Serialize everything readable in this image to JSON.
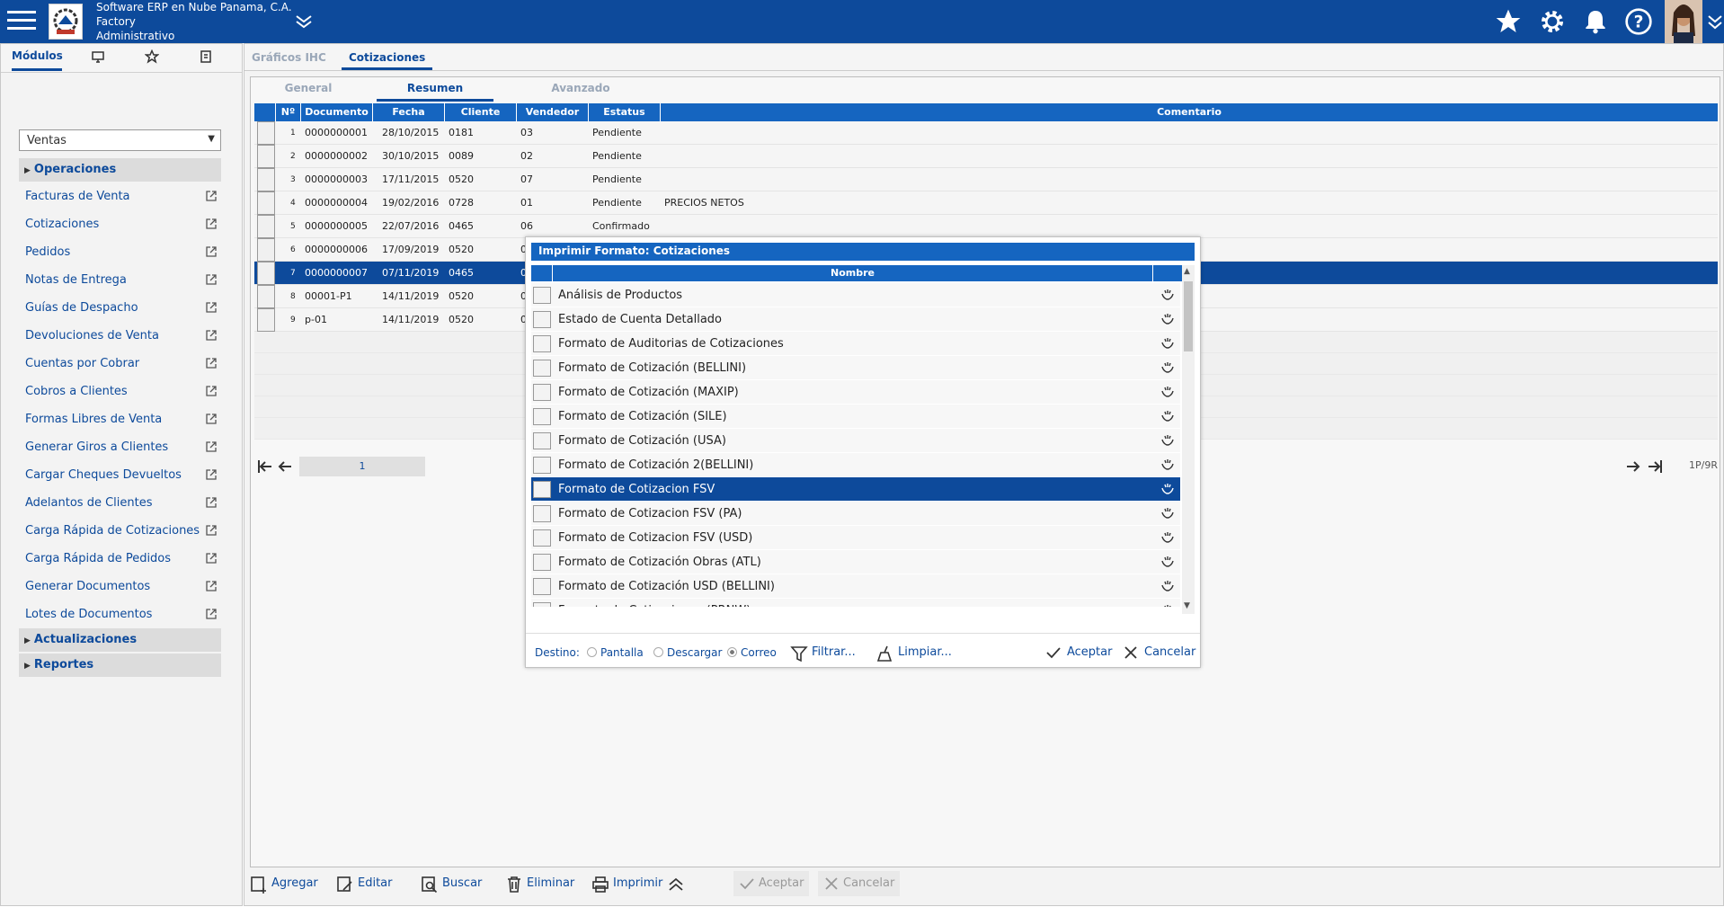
{
  "header": {
    "company": "Software ERP en Nube Panama, C.A.",
    "factory": "Factory",
    "role": "Administrativo"
  },
  "left": {
    "tabs": {
      "modulos": "Módulos"
    },
    "select_value": "Ventas",
    "sections": {
      "operaciones": "Operaciones",
      "actualizaciones": "Actualizaciones",
      "reportes": "Reportes"
    },
    "items": [
      "Facturas de Venta",
      "Cotizaciones",
      "Pedidos",
      "Notas de Entrega",
      "Guías de Despacho",
      "Devoluciones de Venta",
      "Cuentas por Cobrar",
      "Cobros a Clientes",
      "Formas Libres de Venta",
      "Generar Giros a Clientes",
      "Cargar Cheques Devueltos",
      "Adelantos de Clientes",
      "Carga Rápida de Cotizaciones",
      "Carga Rápida de Pedidos",
      "Generar Documentos",
      "Lotes de Documentos"
    ]
  },
  "main": {
    "tabs": [
      "Gráficos IHC",
      "Cotizaciones"
    ],
    "inner_tabs": [
      "General",
      "Resumen",
      "Avanzado"
    ],
    "columns": [
      "Nº",
      "Documento",
      "Fecha",
      "Cliente",
      "Vendedor",
      "Estatus",
      "Comentario"
    ],
    "rows": [
      {
        "n": "1",
        "doc": "0000000001",
        "fecha": "28/10/2015",
        "cliente": "0181",
        "vend": "03",
        "estatus": "Pendiente",
        "coment": ""
      },
      {
        "n": "2",
        "doc": "0000000002",
        "fecha": "30/10/2015",
        "cliente": "0089",
        "vend": "02",
        "estatus": "Pendiente",
        "coment": ""
      },
      {
        "n": "3",
        "doc": "0000000003",
        "fecha": "17/11/2015",
        "cliente": "0520",
        "vend": "07",
        "estatus": "Pendiente",
        "coment": ""
      },
      {
        "n": "4",
        "doc": "0000000004",
        "fecha": "19/02/2016",
        "cliente": "0728",
        "vend": "01",
        "estatus": "Pendiente",
        "coment": "PRECIOS NETOS"
      },
      {
        "n": "5",
        "doc": "0000000005",
        "fecha": "22/07/2016",
        "cliente": "0465",
        "vend": "06",
        "estatus": "Confirmado",
        "coment": ""
      },
      {
        "n": "6",
        "doc": "0000000006",
        "fecha": "17/09/2019",
        "cliente": "0520",
        "vend": "0",
        "estatus": "",
        "coment": ""
      },
      {
        "n": "7",
        "doc": "0000000007",
        "fecha": "07/11/2019",
        "cliente": "0465",
        "vend": "0",
        "estatus": "",
        "coment": ""
      },
      {
        "n": "8",
        "doc": "00001-P1",
        "fecha": "14/11/2019",
        "cliente": "0520",
        "vend": "0",
        "estatus": "",
        "coment": ""
      },
      {
        "n": "9",
        "doc": "p-01",
        "fecha": "14/11/2019",
        "cliente": "0520",
        "vend": "0",
        "estatus": "",
        "coment": ""
      }
    ],
    "pager": {
      "page": "1",
      "info": "1P/9R"
    },
    "actions": {
      "agregar": "Agregar",
      "editar": "Editar",
      "buscar": "Buscar",
      "eliminar": "Eliminar",
      "imprimir": "Imprimir",
      "aceptar": "Aceptar",
      "cancelar": "Cancelar"
    }
  },
  "modal": {
    "title": "Imprimir Formato: Cotizaciones",
    "column": "Nombre",
    "items": [
      "Análisis de Productos",
      "Estado de Cuenta Detallado",
      "Formato de Auditorias de Cotizaciones",
      "Formato de Cotización (BELLINI)",
      "Formato de Cotización (MAXIP)",
      "Formato de Cotización (SILE)",
      "Formato de Cotización (USA)",
      "Formato de Cotización 2(BELLINI)",
      "Formato de Cotizacion FSV",
      "Formato de Cotizacion FSV (PA)",
      "Formato de Cotizacion FSV (USD)",
      "Formato de Cotización Obras (ATL)",
      "Formato de Cotización USD (BELLINI)",
      "Formato de Cotizaciones (PRNW)"
    ],
    "destino_label": "Destino:",
    "destinos": [
      "Pantalla",
      "Descargar",
      "Correo"
    ],
    "filtrar": "Filtrar...",
    "limpiar": "Limpiar...",
    "aceptar": "Aceptar",
    "cancelar": "Cancelar"
  }
}
